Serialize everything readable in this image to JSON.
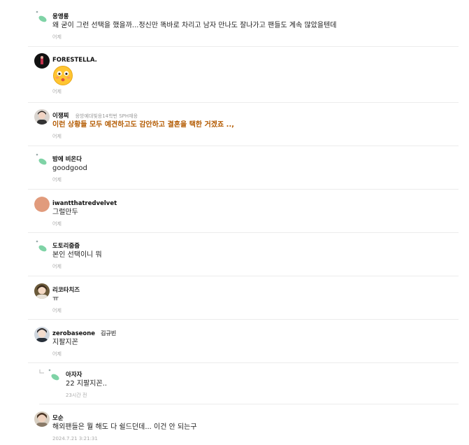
{
  "comments": [
    {
      "nickname": "웅앵룽",
      "text": "왜 굳이 그런 선택을 했을까...정신만 똑바로 차리고 남자 만나도 잘나가고 팬들도 계속 많았을텐데",
      "date": "어제",
      "avatar": "leaf-icon"
    },
    {
      "nickname": "FORESTELLA.",
      "emoticon": "flushed-face-emoticon",
      "date": "어제",
      "avatar": "profile-photo-dark"
    },
    {
      "nickname": "이쟁찌",
      "badge": "응방예대빛응14학번 SPH재응",
      "text": "이런 상황들 모두 예견하고도 감안하고 결혼을 택한 거겠죠 ..,",
      "date": "어제",
      "avatar": "profile-photo-person"
    },
    {
      "nickname": "밤에 비온다",
      "text": "goodgood",
      "date": "어제",
      "avatar": "leaf-icon"
    },
    {
      "nickname": "iwantthatredvelvet",
      "text": "그럴만두",
      "date": "어제",
      "avatar": "profile-circle-salmon"
    },
    {
      "nickname": "도토리줍줍",
      "text": "본인 선택이니 뭐",
      "date": "어제",
      "avatar": "leaf-icon"
    },
    {
      "nickname": "리코타치즈",
      "text": "ㅠ",
      "date": "어제",
      "avatar": "profile-photo-person"
    },
    {
      "nickname": "zerobaseone",
      "nickname_sub": "김규빈",
      "text": "지팔지꼰",
      "date": "어제",
      "avatar": "profile-photo-person"
    },
    {
      "nickname": "아자자",
      "text": "22 지팔지꼰..",
      "date": "23시간 전",
      "avatar": "leaf-icon",
      "is_reply": true
    },
    {
      "nickname": "모순",
      "text": "해외팬들은 뭘 해도 다 쉴드던데... 이건 안 되는구",
      "date": "2024.7.21 3:21:31",
      "avatar": "profile-photo-person"
    }
  ],
  "colors": {
    "leaf": "#7fd3a6",
    "highlight_text": "#b35a00",
    "separator": "#ececec",
    "date": "#aaaaaa"
  }
}
